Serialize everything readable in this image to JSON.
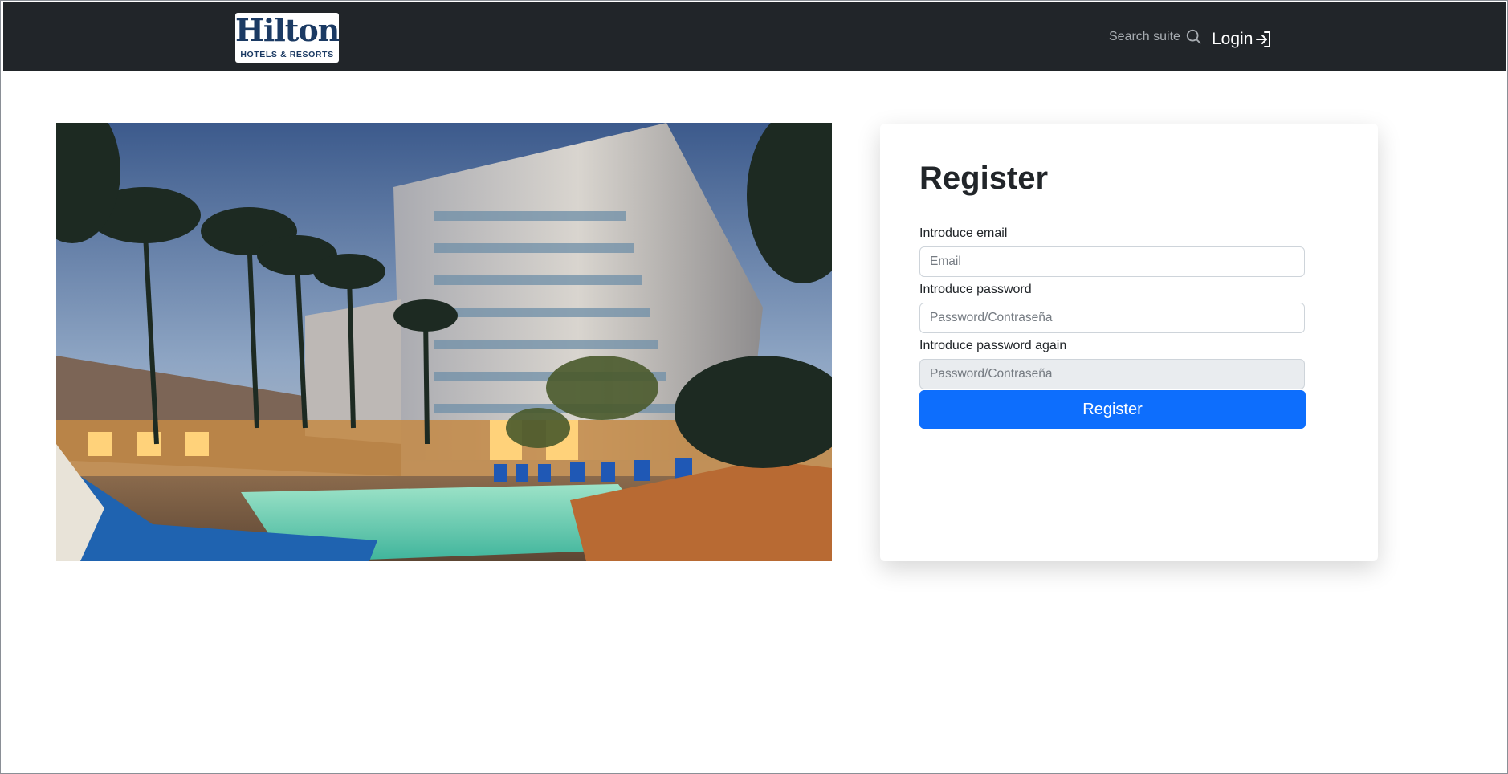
{
  "navbar": {
    "logo": {
      "name": "Hilton",
      "tagline": "HOTELS & RESORTS"
    },
    "search_label": "Search suite",
    "login_label": "Login"
  },
  "register": {
    "title": "Register",
    "email_label": "Introduce email",
    "email_placeholder": "Email",
    "password_label": "Introduce password",
    "password_placeholder": "Password/Contraseña",
    "password_again_label": "Introduce password again",
    "password_again_placeholder": "Password/Contraseña",
    "submit_label": "Register"
  },
  "colors": {
    "navbar_bg": "#212529",
    "brand_navy": "#1b3a63",
    "button_primary": "#0d6efd",
    "disabled_input_bg": "#e9ecef"
  },
  "icons": [
    "search-icon",
    "login-arrow-icon"
  ]
}
